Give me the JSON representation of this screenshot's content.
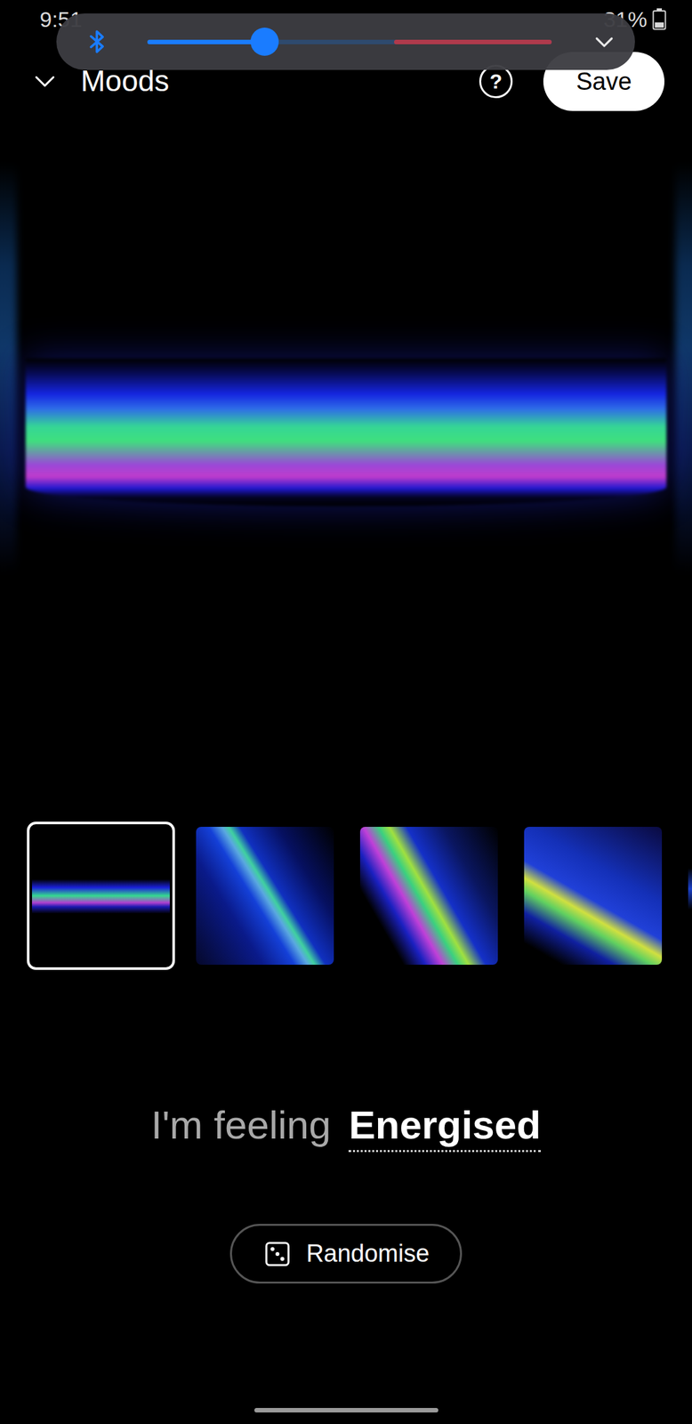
{
  "status_bar": {
    "time": "9:51",
    "battery": "31%"
  },
  "volume_panel": {
    "level": 0.29,
    "warning_level": 0.61
  },
  "header": {
    "title": "Moods",
    "help": "?",
    "save": "Save"
  },
  "thumbnails": [
    {
      "selected": true
    },
    {
      "selected": false
    },
    {
      "selected": false
    },
    {
      "selected": false
    },
    {
      "selected": false
    }
  ],
  "mood": {
    "prefix": "I'm feeling",
    "value": "Energised"
  },
  "randomise": {
    "label": "Randomise"
  }
}
